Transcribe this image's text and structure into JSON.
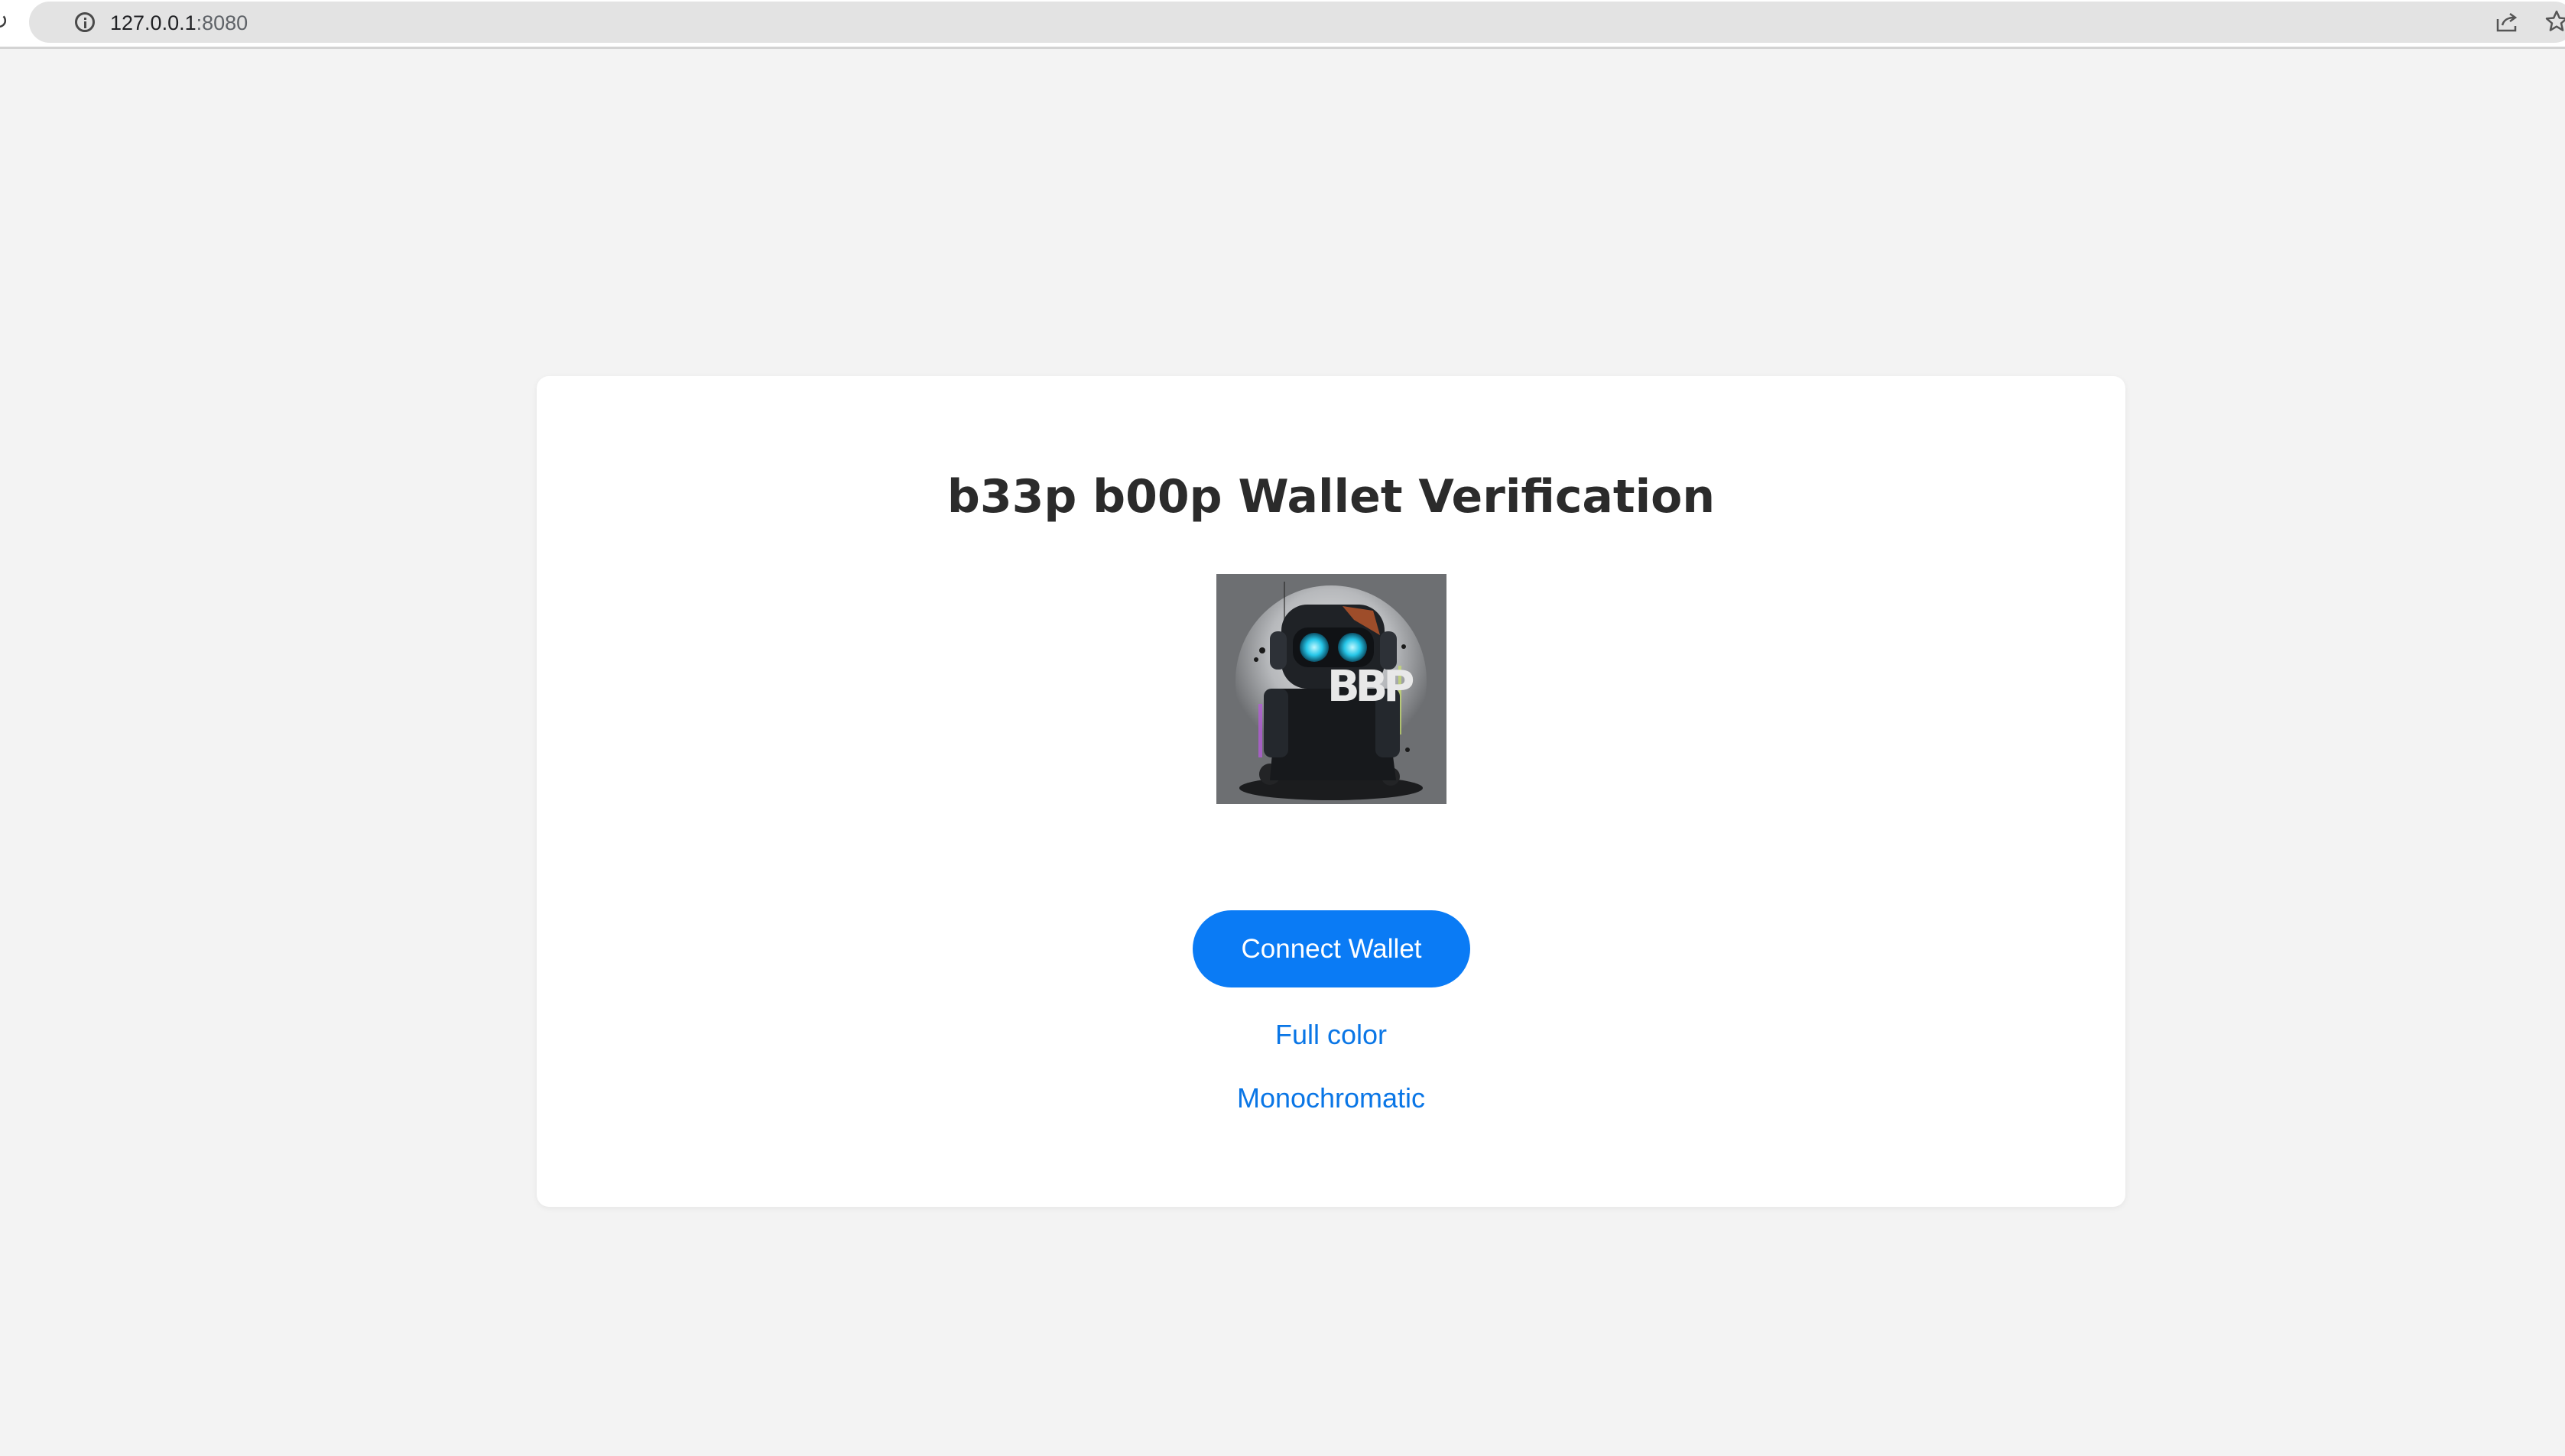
{
  "browser": {
    "url_host": "127.0.0.1",
    "url_port": ":8080",
    "icons": {
      "site_info": "info-icon",
      "share": "share-icon",
      "bookmark": "star-icon"
    }
  },
  "page": {
    "title": "b33p b00p Wallet Verification",
    "logo_text": "BBP",
    "connect_button_label": "Connect Wallet",
    "links": {
      "full_color": "Full color",
      "monochromatic": "Monochromatic"
    }
  },
  "colors": {
    "page_background": "#f3f3f3",
    "card_background": "#ffffff",
    "accent": "#0a7bf5",
    "link": "#0a76e6",
    "title_text": "#2b2b2b"
  }
}
